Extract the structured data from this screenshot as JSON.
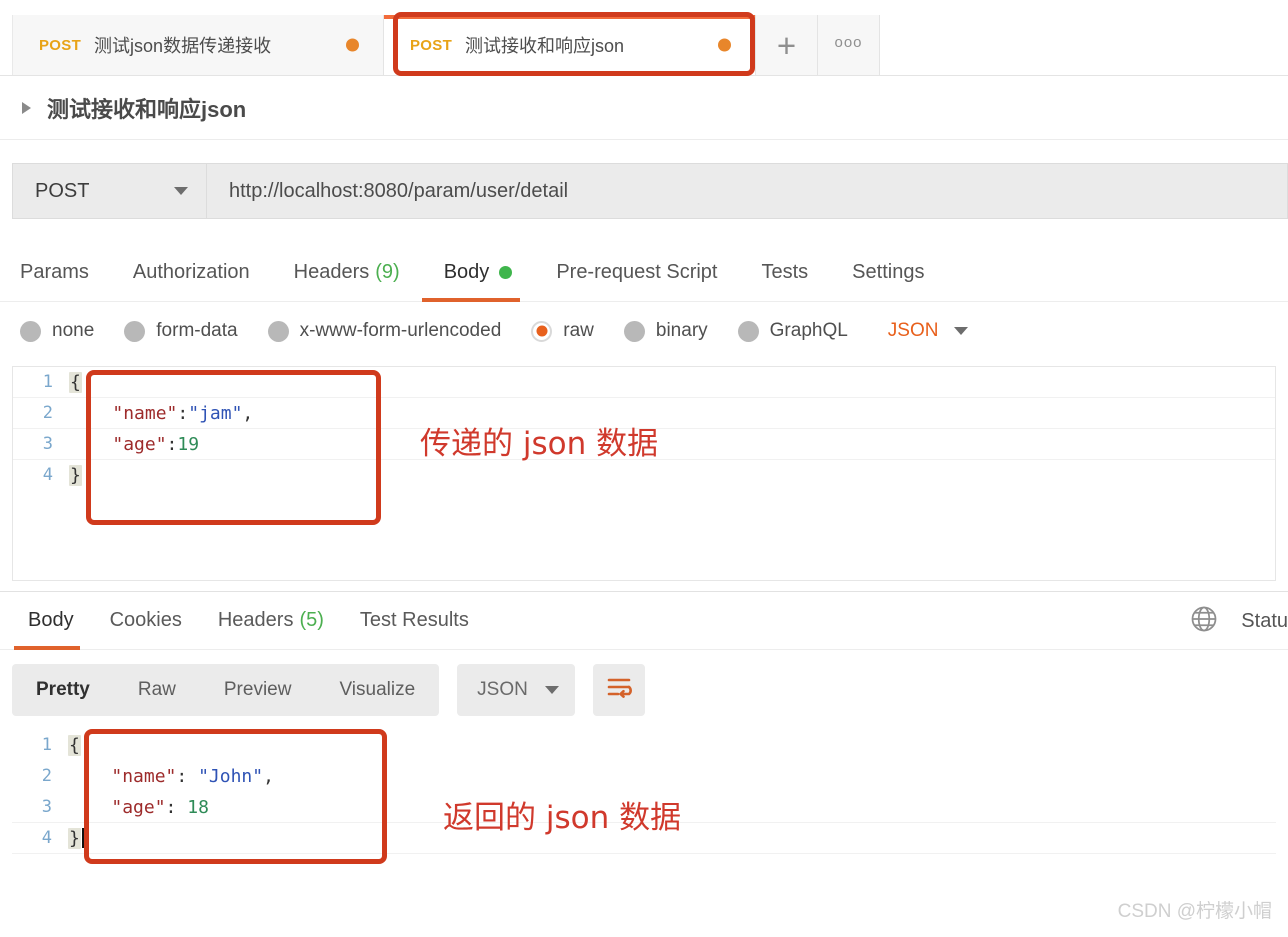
{
  "colors": {
    "accent_orange": "#e0622c",
    "tab_top_orange": "#f26b3a",
    "method_yellow": "#e8a317",
    "unsaved_dot": "#e8862b",
    "green_count": "#4caf50",
    "annotation_red": "#d0392c",
    "json_key": "#9d2b2b",
    "json_string": "#2f53b5",
    "json_number": "#2e8b57",
    "line_number": "#7aa7cc"
  },
  "tabs": {
    "items": [
      {
        "method": "POST",
        "name": "测试json数据传递接收",
        "dot": true,
        "active": false
      },
      {
        "method": "POST",
        "name": "测试接收和响应json",
        "dot": true,
        "active": true
      }
    ],
    "new_tab_label": "+",
    "more_label": "ooo"
  },
  "request": {
    "title": "测试接收和响应json",
    "method": "POST",
    "url": "http://localhost:8080/param/user/detail",
    "tabs": [
      {
        "label": "Params",
        "count": "",
        "active": false,
        "dot": false
      },
      {
        "label": "Authorization",
        "count": "",
        "active": false,
        "dot": false
      },
      {
        "label": "Headers",
        "count": "(9)",
        "active": false,
        "dot": false
      },
      {
        "label": "Body",
        "count": "",
        "active": true,
        "dot": true
      },
      {
        "label": "Pre-request Script",
        "count": "",
        "active": false,
        "dot": false
      },
      {
        "label": "Tests",
        "count": "",
        "active": false,
        "dot": false
      },
      {
        "label": "Settings",
        "count": "",
        "active": false,
        "dot": false
      }
    ],
    "body_types": [
      {
        "label": "none",
        "checked": false
      },
      {
        "label": "form-data",
        "checked": false
      },
      {
        "label": "x-www-form-urlencoded",
        "checked": false
      },
      {
        "label": "raw",
        "checked": true
      },
      {
        "label": "binary",
        "checked": false
      },
      {
        "label": "GraphQL",
        "checked": false
      }
    ],
    "raw_format": "JSON",
    "body_lines": [
      {
        "num": "1",
        "open_brace": "{",
        "text": ""
      },
      {
        "num": "2",
        "open_brace": "",
        "text": "    \"name\":\"jam\","
      },
      {
        "num": "3",
        "open_brace": "",
        "text": "    \"age\":19"
      },
      {
        "num": "4",
        "open_brace": "}",
        "text": ""
      }
    ],
    "body_tokens": {
      "line2_key": "\"name\"",
      "line2_colon": ":",
      "line2_value": "\"jam\"",
      "line2_comma": ",",
      "line3_key": "\"age\"",
      "line3_colon": ":",
      "line3_value": "19"
    },
    "annotation": "传递的 json 数据"
  },
  "response": {
    "tabs": [
      {
        "label": "Body",
        "count": "",
        "active": true
      },
      {
        "label": "Cookies",
        "count": "",
        "active": false
      },
      {
        "label": "Headers",
        "count": "(5)",
        "active": false
      },
      {
        "label": "Test Results",
        "count": "",
        "active": false
      }
    ],
    "status_label": "Statu",
    "view_modes": [
      {
        "label": "Pretty",
        "active": true
      },
      {
        "label": "Raw",
        "active": false
      },
      {
        "label": "Preview",
        "active": false
      },
      {
        "label": "Visualize",
        "active": false
      }
    ],
    "format": "JSON",
    "body_lines": [
      {
        "num": "1",
        "open_brace": "{",
        "text": ""
      },
      {
        "num": "2",
        "open_brace": "",
        "text": "    \"name\": \"John\","
      },
      {
        "num": "3",
        "open_brace": "",
        "text": "    \"age\": 18"
      },
      {
        "num": "4",
        "open_brace": "}",
        "text": ""
      }
    ],
    "body_tokens": {
      "line2_key": "\"name\"",
      "line2_colon": ": ",
      "line2_value": "\"John\"",
      "line2_comma": ",",
      "line3_key": "\"age\"",
      "line3_colon": ": ",
      "line3_value": "18"
    },
    "annotation": "返回的 json 数据"
  },
  "watermark": "CSDN @柠檬小帽"
}
